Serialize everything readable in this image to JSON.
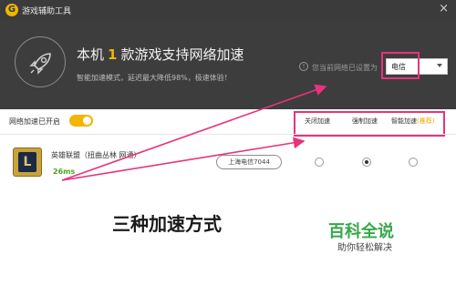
{
  "window": {
    "logo_letter": "G",
    "title": "游戏辅助工具",
    "close_glyph": "×"
  },
  "header": {
    "headline_prefix": "本机",
    "game_count": "1",
    "headline_suffix": "款游戏支持网络加速",
    "subline": "智能加速模式，延迟最大降低98%，极速体验！",
    "network_label": "您当前网络已设置为",
    "network_value": "电信"
  },
  "toggle": {
    "label": "网络加速已开启",
    "on": true
  },
  "modes": {
    "off": "关闭加速",
    "force": "强制加速",
    "smart": "智能加速",
    "smart_tag": "(推荐)",
    "selected": "force"
  },
  "game": {
    "name": "英雄联盟（扭曲丛林 网通）",
    "ping": "26ms",
    "server": "上海电信7044",
    "icon_letter": "L"
  },
  "captions": {
    "main": "三种加速方式",
    "brand": "百科全说",
    "brand_sub": "助你轻松解决"
  },
  "colors": {
    "accent_yellow": "#f3b500",
    "highlight_pink": "#e8337c",
    "ping_green": "#4da623",
    "brand_green": "#35a84a",
    "header_bg": "#3d3d3d"
  }
}
